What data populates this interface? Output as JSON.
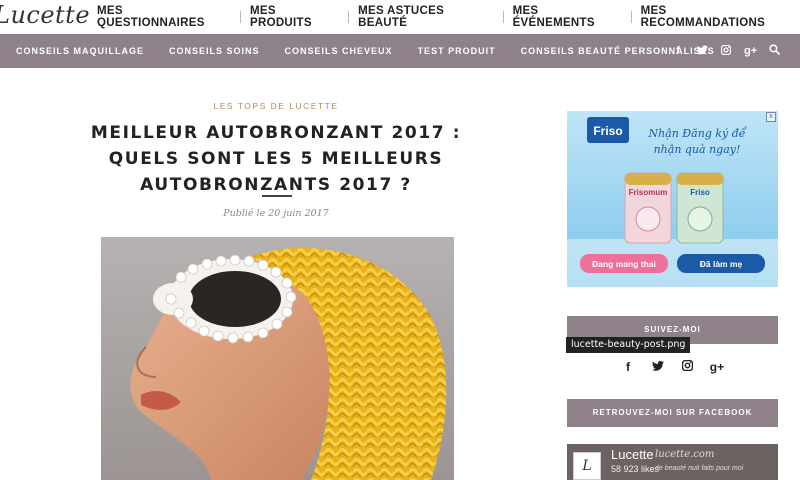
{
  "brand": {
    "logo_text": "Lucette"
  },
  "top_menu": [
    "MES QUESTIONNAIRES",
    "MES PRODUITS",
    "MES ASTUCES BEAUTÉ",
    "MES ÉVÉNEMENTS",
    "MES RECOMMANDATIONS"
  ],
  "sub_menu": [
    "CONSEILS MAQUILLAGE",
    "CONSEILS SOINS",
    "CONSEILS CHEVEUX",
    "TEST PRODUIT",
    "CONSEILS BEAUTÉ PERSONNALISÉS"
  ],
  "header_social": {
    "facebook": "f",
    "twitter_icon": "twitter-icon",
    "instagram_icon": "instagram-icon",
    "googleplus": "g+",
    "search_icon": "search-icon"
  },
  "article": {
    "category": "LES TOPS DE LUCETTE",
    "title_lines": [
      "MEILLEUR AUTOBRONZANT 2017 :",
      "QUELS SONT LES 5 MEILLEURS",
      "AUTOBRONZANTS 2017 ?"
    ],
    "date": "Publié le 20 juin 2017"
  },
  "ad": {
    "brand": "Friso",
    "headline_1": "Nhận Đăng ký để",
    "headline_2": "nhận quà ngay!",
    "can_1": "Frisomum",
    "can_2": "Friso",
    "btn_1": "Đang mang thai",
    "btn_2": "Đã làm mẹ",
    "close": "x"
  },
  "sidebar": {
    "follow_title": "SUIVEZ-MOI",
    "tooltip": "lucette-beauty-post.png",
    "follow_social": {
      "facebook": "f",
      "twitter_icon": "twitter-icon",
      "instagram_icon": "instagram-icon",
      "googleplus": "g+"
    },
    "facebook_title": "RETROUVEZ-MOI SUR FACEBOOK",
    "fb_page_name": "Lucette",
    "fb_page_url": "lucette.com",
    "fb_likes": "58 923 likes",
    "fb_tagline": "de beauté nuit faits pour moi"
  },
  "colors": {
    "accent_bar": "#8f818a",
    "category_gold": "#b08d5b",
    "ad_blue": "#9fd3ee"
  }
}
